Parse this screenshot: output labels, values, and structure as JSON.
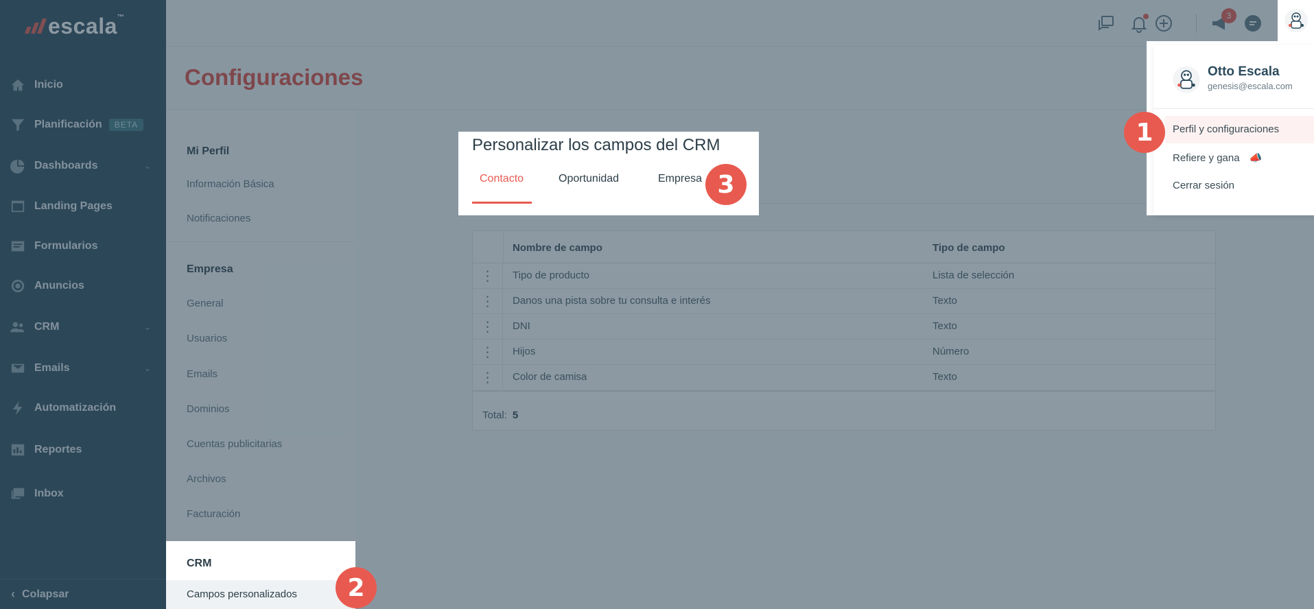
{
  "brand": {
    "name": "escala",
    "tm": "™"
  },
  "sidebar": {
    "items": [
      {
        "label": "Inicio",
        "icon": "home-icon"
      },
      {
        "label": "Planificación",
        "icon": "funnel-icon",
        "badge": "BETA"
      },
      {
        "label": "Dashboards",
        "icon": "pie-chart-icon"
      },
      {
        "label": "Landing Pages",
        "icon": "landing-page-icon"
      },
      {
        "label": "Formularios",
        "icon": "form-icon"
      },
      {
        "label": "Anuncios",
        "icon": "target-icon"
      },
      {
        "label": "CRM",
        "icon": "people-icon"
      },
      {
        "label": "Emails",
        "icon": "mail-icon"
      },
      {
        "label": "Automatización",
        "icon": "lightning-icon"
      },
      {
        "label": "Reportes",
        "icon": "report-icon"
      },
      {
        "label": "Inbox",
        "icon": "inbox-icon"
      }
    ],
    "collapse_label": "Colapsar"
  },
  "topbar": {
    "notifications_badge": "3"
  },
  "page": {
    "title": "Configuraciones"
  },
  "settings_menu": {
    "sections": [
      {
        "title": "Mi Perfil",
        "items": [
          "Información Básica",
          "Notificaciones"
        ]
      },
      {
        "title": "Empresa",
        "items": [
          "General",
          "Usuarios",
          "Emails",
          "Dominios",
          "Cuentas publicitarias",
          "Archivos",
          "Facturación"
        ]
      },
      {
        "title": "CRM",
        "items": [
          "Campos personalizados"
        ]
      }
    ]
  },
  "crm": {
    "title": "Personalizar los campos del CRM",
    "tabs": [
      "Contacto",
      "Oportunidad",
      "Empresa"
    ]
  },
  "table": {
    "headers": [
      "Nombre de campo",
      "Tipo de campo"
    ],
    "rows": [
      [
        "Tipo de producto",
        "Lista de selección"
      ],
      [
        "Danos una pista sobre tu consulta e interés",
        "Texto"
      ],
      [
        "DNI",
        "Texto"
      ],
      [
        "Hijos",
        "Número"
      ],
      [
        "Color de camisa",
        "Texto"
      ]
    ],
    "total_label": "Total:",
    "total_value": "5"
  },
  "user": {
    "name": "Otto Escala",
    "email": "genesis@escala.com",
    "menu": [
      "Perfil y configuraciones",
      "Refiere y gana",
      "Cerrar sesión"
    ]
  },
  "steps": [
    "1",
    "2",
    "3"
  ],
  "colors": {
    "accent": "#e85a4f",
    "sidebar": "#2c4b5c"
  }
}
